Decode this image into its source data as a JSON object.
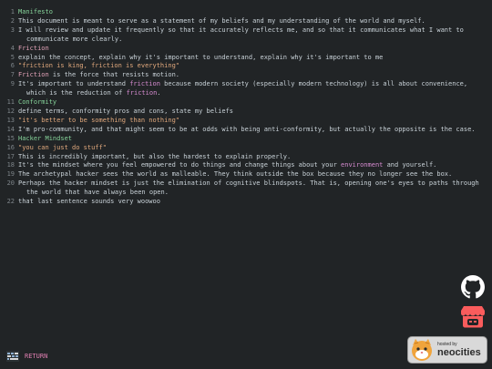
{
  "lines": [
    {
      "n": "1",
      "segs": [
        {
          "t": "Manifesto",
          "c": "h"
        }
      ]
    },
    {
      "n": "2",
      "segs": [
        {
          "t": "This document is meant to serve as a statement of my beliefs and my understanding of the world and myself.",
          "c": "default"
        }
      ]
    },
    {
      "n": "3",
      "segs": [
        {
          "t": "I will review and update it frequently so that it accurately reflects me, and so that it communicates what I want to communicate more clearly.",
          "c": "default"
        }
      ],
      "wrap": true
    },
    {
      "n": "4",
      "segs": [
        {
          "t": "Friction",
          "c": "em"
        }
      ]
    },
    {
      "n": "5",
      "segs": [
        {
          "t": "explain the concept, explain why it's important to understand, explain why it's important to me",
          "c": "default"
        }
      ]
    },
    {
      "n": "6",
      "segs": [
        {
          "t": "\"friction is king, friction is everything\"",
          "c": "q"
        }
      ]
    },
    {
      "n": "7",
      "segs": [
        {
          "t": "Friction",
          "c": "em"
        },
        {
          "t": " is the force that resists motion.",
          "c": "default"
        }
      ]
    },
    {
      "n": "9",
      "segs": [
        {
          "t": "It's important to understand ",
          "c": "default"
        },
        {
          "t": "friction",
          "c": "acc"
        },
        {
          "t": " because modern society (especially modern technology) is all about convenience, which is the reduction of ",
          "c": "default"
        },
        {
          "t": "friction",
          "c": "acc"
        },
        {
          "t": ".",
          "c": "default"
        }
      ],
      "wrap": true
    },
    {
      "n": "11",
      "segs": [
        {
          "t": "Conformity",
          "c": "h"
        }
      ]
    },
    {
      "n": "12",
      "segs": [
        {
          "t": "define terms, conformity pros and cons, state my beliefs",
          "c": "default"
        }
      ]
    },
    {
      "n": "13",
      "segs": [
        {
          "t": "\"it's better to be something than nothing\"",
          "c": "q"
        }
      ]
    },
    {
      "n": "14",
      "segs": [
        {
          "t": "I'm pro-community, and that might seem to be at odds with being anti-conformity, but actually the opposite is the case.",
          "c": "default"
        }
      ]
    },
    {
      "n": "15",
      "segs": [
        {
          "t": "Hacker Mindset",
          "c": "h"
        }
      ]
    },
    {
      "n": "16",
      "segs": [
        {
          "t": "\"you can just do stuff\"",
          "c": "q"
        }
      ]
    },
    {
      "n": "17",
      "segs": [
        {
          "t": "This is incredibly important, but also the hardest to explain properly.",
          "c": "default"
        }
      ]
    },
    {
      "n": "18",
      "segs": [
        {
          "t": "It's the mindset where you feel empowered to do things and change things about your ",
          "c": "default"
        },
        {
          "t": "environment",
          "c": "acc"
        },
        {
          "t": " and yourself.",
          "c": "default"
        }
      ]
    },
    {
      "n": "19",
      "segs": [
        {
          "t": "The archetypal hacker sees the world as malleable. They think outside the box because they no longer see the box.",
          "c": "default"
        }
      ]
    },
    {
      "n": "20",
      "segs": [
        {
          "t": "Perhaps the hacker mindset is just the elimination of cognitive blindspots. That is, opening one's eyes to paths through the world that have always been open.",
          "c": "default"
        }
      ],
      "wrap": true
    },
    {
      "n": "22",
      "segs": [
        {
          "t": "that last sentence sounds very woowoo",
          "c": "default"
        }
      ]
    }
  ],
  "footer": {
    "return_label": "RETURN",
    "return_icon": "keyboard-return-icon"
  },
  "side_links": [
    {
      "name": "github",
      "icon": "github-icon"
    },
    {
      "name": "itch",
      "icon": "itch-io-icon"
    }
  ],
  "badge": {
    "hosted_by": "hosted by",
    "brand": "neocities"
  },
  "colors": {
    "background": "#212426",
    "text": "#c9d2d8",
    "heading": "#86d39a",
    "emphasis": "#e3a3b8",
    "quote": "#e2a97d",
    "accent": "#d68bd0",
    "line_number": "#7d8489",
    "return": "#e07fb2"
  }
}
